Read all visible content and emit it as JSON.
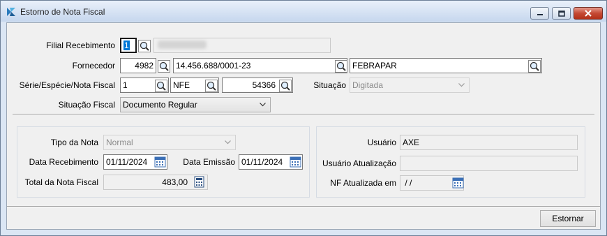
{
  "window": {
    "title": "Estorno de Nota Fiscal",
    "accent_color": "#c54a35"
  },
  "labels": {
    "filial": "Filial Recebimento",
    "fornecedor": "Fornecedor",
    "serie": "Série/Espécie/Nota Fiscal",
    "situacao": "Situação",
    "situacao_fiscal": "Situação Fiscal",
    "tipo_nota": "Tipo da Nota",
    "data_recebimento": "Data Recebimento",
    "data_emissao": "Data Emissão",
    "total_nota": "Total da Nota Fiscal",
    "usuario": "Usuário",
    "usuario_atualizacao": "Usuário Atualização",
    "nf_atualizada": "NF Atualizada em"
  },
  "values": {
    "filial_code": "1",
    "fornecedor_code": "4982",
    "fornecedor_cnpj": "14.456.688/0001-23",
    "fornecedor_name": "FEBRAPAR",
    "serie": "1",
    "especie": "NFE",
    "nota_fiscal": "54366",
    "situacao": "Digitada",
    "situacao_fiscal": "Documento Regular",
    "tipo_nota": "Normal",
    "data_recebimento": "01/11/2024",
    "data_emissao": "01/11/2024",
    "total_nota": "483,00",
    "usuario": "AXE",
    "usuario_atualizacao": "",
    "nf_atualizada": " / /"
  },
  "buttons": {
    "estornar": "Estornar"
  },
  "icons": {
    "lookup": "magnifier-lookup-icon",
    "calendar": "calendar-icon",
    "calculator": "calculator-icon",
    "dropdown": "chevron-down-icon"
  }
}
